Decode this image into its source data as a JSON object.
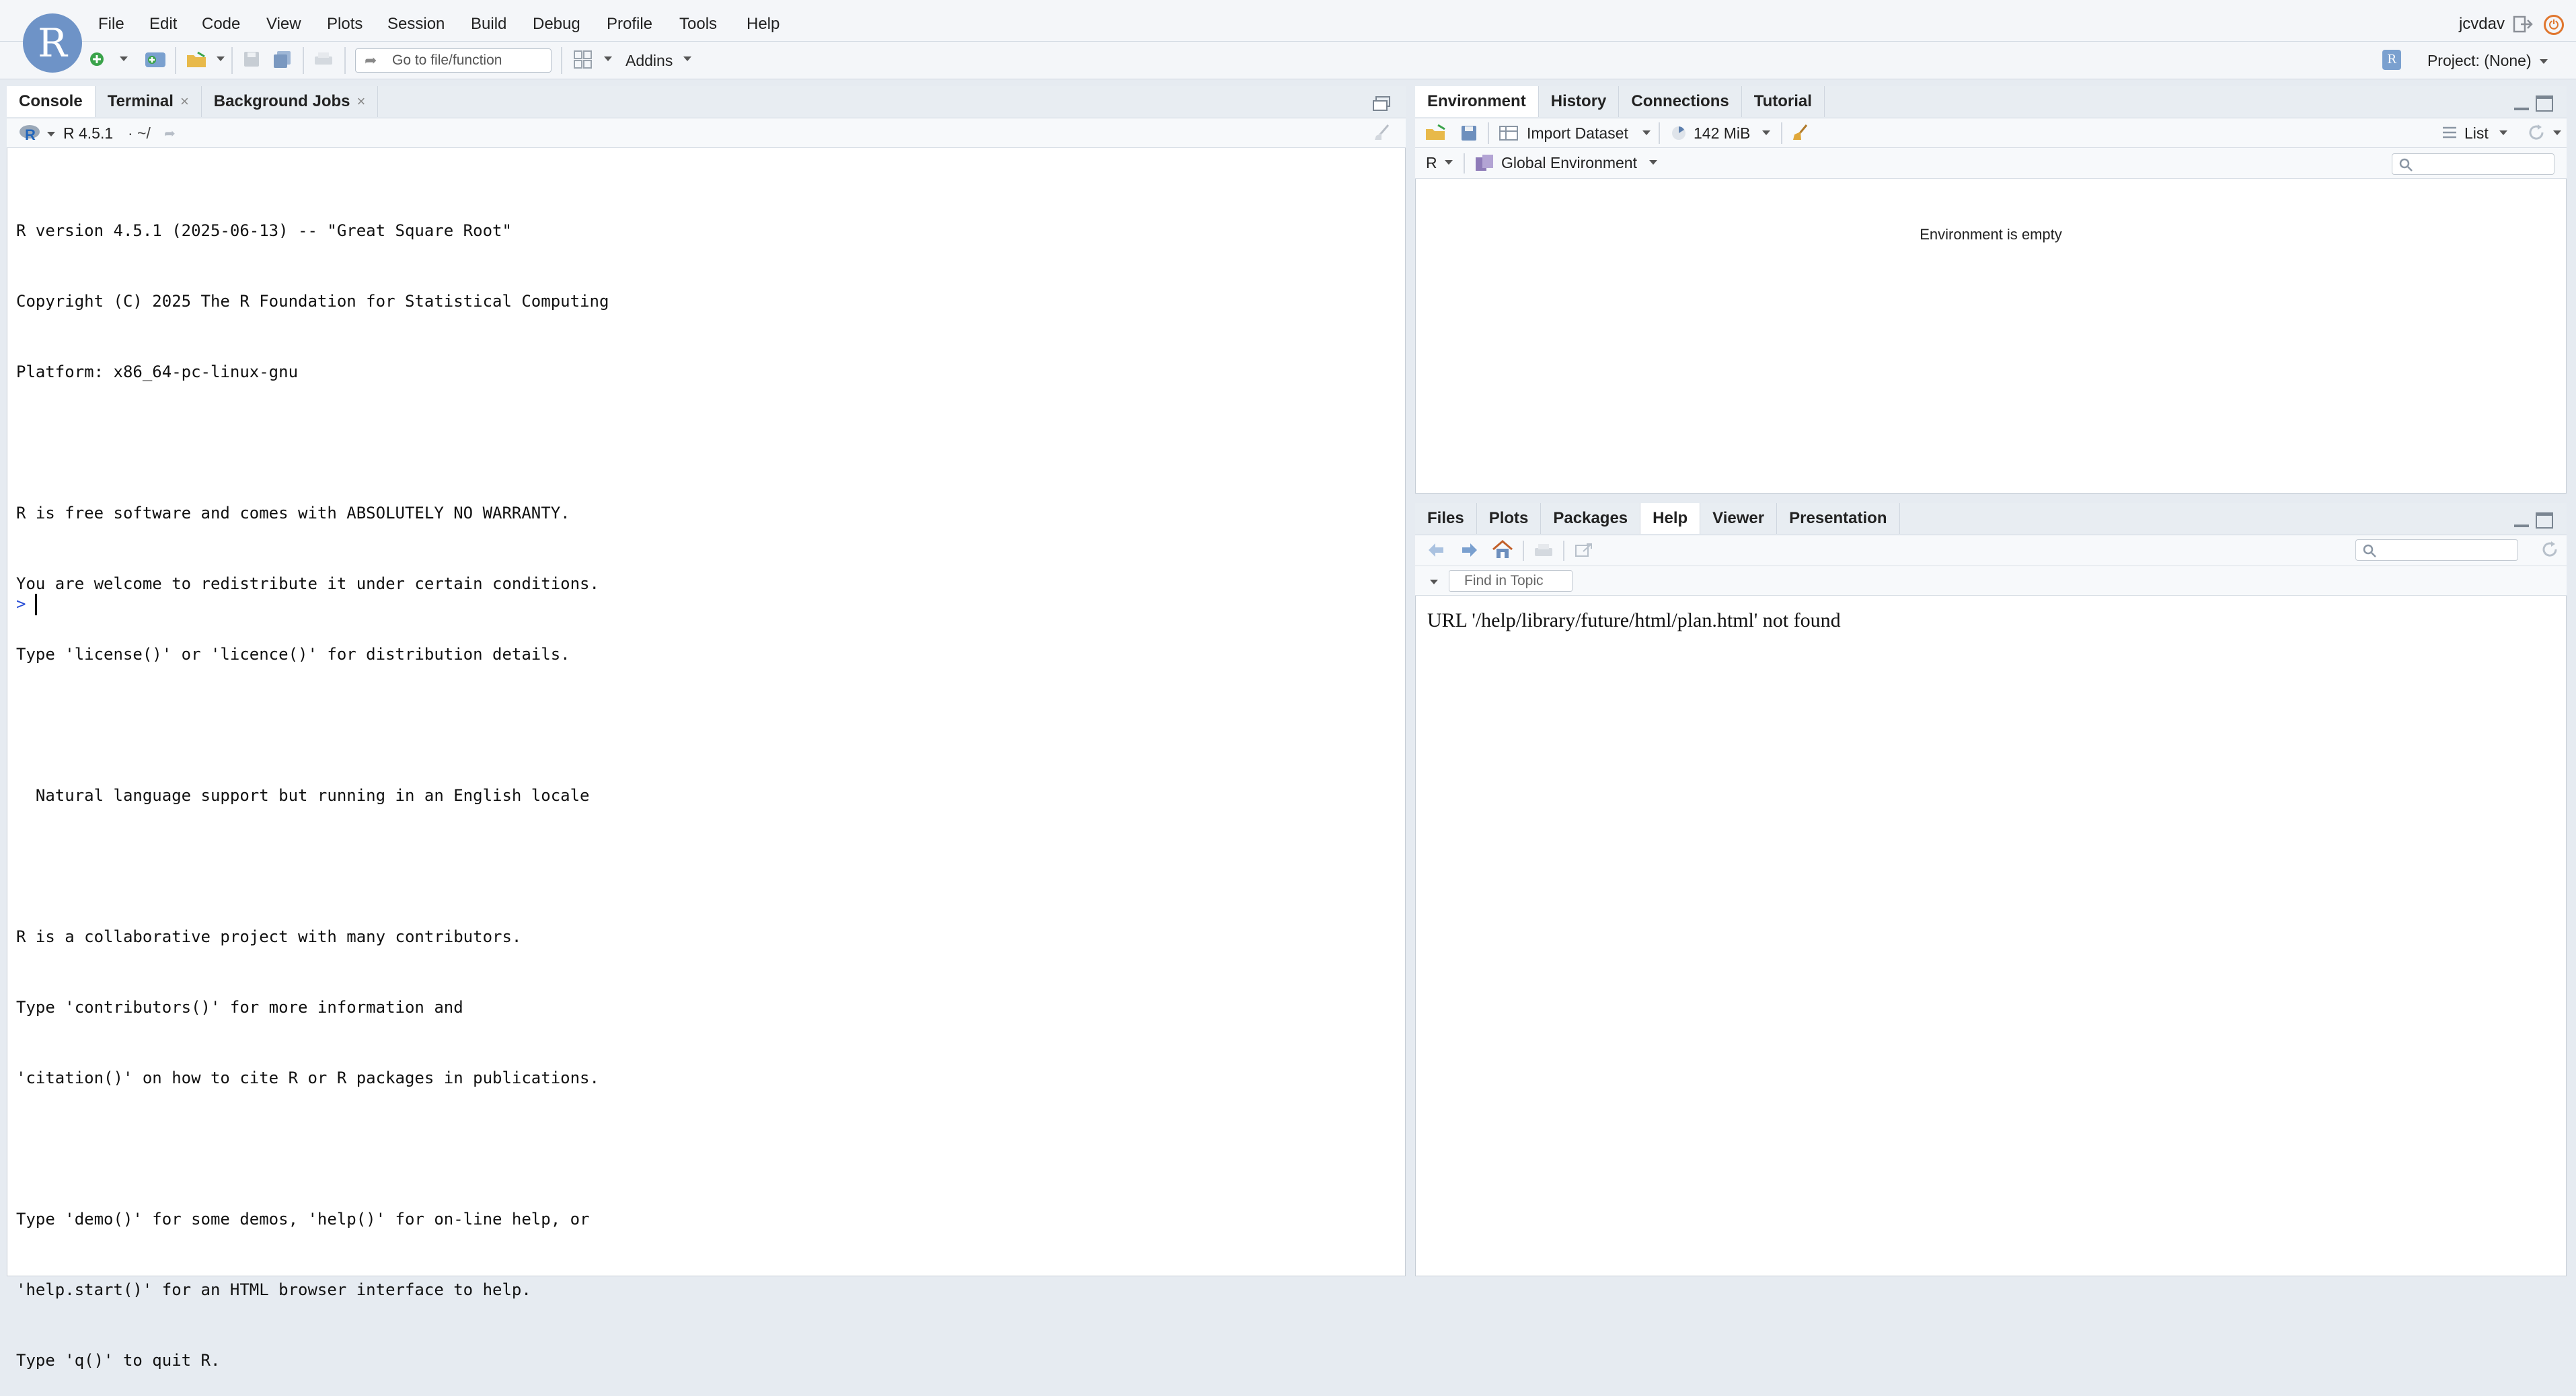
{
  "menu": {
    "items": [
      "File",
      "Edit",
      "Code",
      "View",
      "Plots",
      "Session",
      "Build",
      "Debug",
      "Profile",
      "Tools",
      "Help"
    ],
    "user": "jcvdav"
  },
  "toolbar": {
    "goto_placeholder": "Go to file/function",
    "addins": "Addins",
    "project": "Project: (None)"
  },
  "console_pane": {
    "tabs": [
      "Console",
      "Terminal",
      "Background Jobs"
    ],
    "r_version_label": "R 4.5.1",
    "path": "· ~/",
    "lines": [
      "R version 4.5.1 (2025-06-13) -- \"Great Square Root\"",
      "Copyright (C) 2025 The R Foundation for Statistical Computing",
      "Platform: x86_64-pc-linux-gnu",
      "",
      "R is free software and comes with ABSOLUTELY NO WARRANTY.",
      "You are welcome to redistribute it under certain conditions.",
      "Type 'license()' or 'licence()' for distribution details.",
      "",
      "  Natural language support but running in an English locale",
      "",
      "R is a collaborative project with many contributors.",
      "Type 'contributors()' for more information and",
      "'citation()' on how to cite R or R packages in publications.",
      "",
      "Type 'demo()' for some demos, 'help()' for on-line help, or",
      "'help.start()' for an HTML browser interface to help.",
      "Type 'q()' to quit R."
    ],
    "prompt": ">"
  },
  "env_pane": {
    "tabs": [
      "Environment",
      "History",
      "Connections",
      "Tutorial"
    ],
    "import_dataset": "Import Dataset",
    "memory": "142 MiB",
    "view_mode": "List",
    "language": "R",
    "scope": "Global Environment",
    "empty_message": "Environment is empty"
  },
  "help_pane": {
    "tabs": [
      "Files",
      "Plots",
      "Packages",
      "Help",
      "Viewer",
      "Presentation"
    ],
    "find_placeholder": "Find in Topic",
    "content": "URL '/help/library/future/html/plan.html' not found"
  },
  "colors": {
    "accent": "#6e93c7",
    "prompt": "#2a4fd6",
    "power": "#e0762e"
  }
}
